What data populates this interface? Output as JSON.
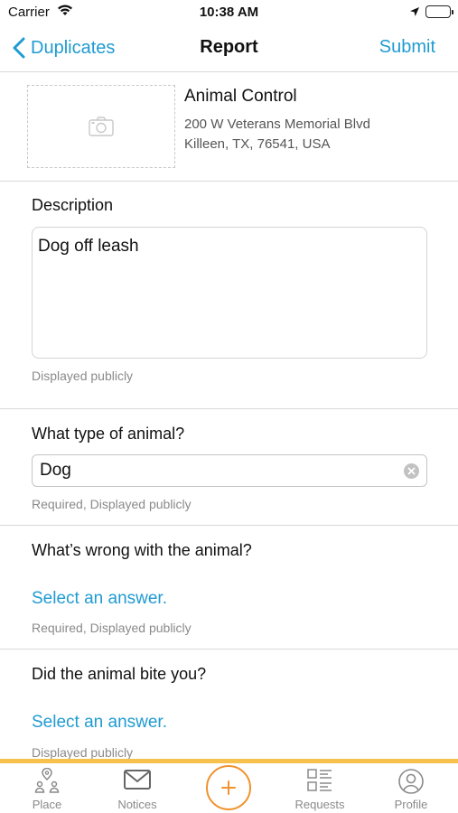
{
  "status_bar": {
    "carrier": "Carrier",
    "time": "10:38 AM"
  },
  "nav": {
    "back_label": "Duplicates",
    "title": "Report",
    "submit_label": "Submit"
  },
  "place": {
    "name": "Animal Control",
    "address_line1": "200 W Veterans Memorial Blvd",
    "address_line2": "Killeen, TX, 76541, USA"
  },
  "form": {
    "description": {
      "label": "Description",
      "value": "Dog off leash",
      "hint": "Displayed publicly"
    },
    "animal_type": {
      "label": "What type of animal?",
      "value": "Dog",
      "hint": "Required, Displayed publicly"
    },
    "whats_wrong": {
      "label": "What’s wrong with the animal?",
      "select_label": "Select an answer.",
      "hint": "Required, Displayed publicly"
    },
    "animal_bite": {
      "label": "Did the animal bite you?",
      "select_label": "Select an answer.",
      "hint": "Displayed publicly"
    }
  },
  "tab_bar": {
    "tabs": [
      {
        "label": "Place",
        "icon": "place-icon"
      },
      {
        "label": "Notices",
        "icon": "mail-icon"
      },
      {
        "label": "",
        "icon": "plus-icon"
      },
      {
        "label": "Requests",
        "icon": "list-icon"
      },
      {
        "label": "Profile",
        "icon": "profile-icon"
      }
    ]
  },
  "colors": {
    "accent": "#1f9bd1",
    "tab_accent": "#f7c14d",
    "add_button": "#f0922e"
  }
}
